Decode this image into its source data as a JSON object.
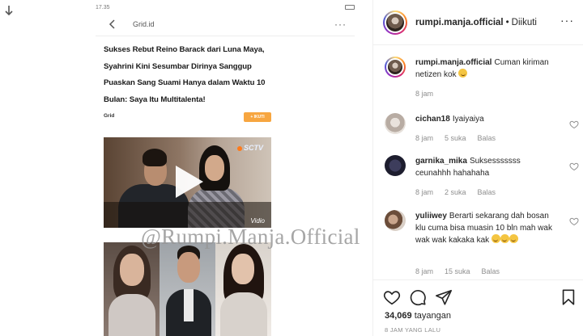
{
  "post": {
    "app_title": "Grid.id",
    "phone_time": "17.35",
    "headline": "Sukses Rebut Reino Barack dari Luna Maya, Syahrini Kini Sesumbar Dirinya Sanggup Puaskan Sang Suami Hanya dalam Waktu 10 Bulan: Saya Itu Multitalenta!",
    "source": "Grid",
    "follow_label": "+ IKUTI",
    "video_channel": "SCTV",
    "video_brand": "Vidio",
    "watermark": "@Rumpi.Manja.Official"
  },
  "header": {
    "username": "rumpi.manja.official",
    "separator": "•",
    "following": "Diikuti",
    "more": "···"
  },
  "caption": {
    "username": "rumpi.manja.official",
    "text": "Cuman kiriman netizen kok",
    "time": "8 jam"
  },
  "comments": [
    {
      "username": "cichan18",
      "text": "Iyaiyaiya",
      "time": "8 jam",
      "likes": "5 suka",
      "reply": "Balas"
    },
    {
      "username": "garnika_mika",
      "text": "Suksesssssss ceunahhh hahahaha",
      "time": "8 jam",
      "likes": "2 suka",
      "reply": "Balas"
    },
    {
      "username": "yuliiwey",
      "text": "Berarti sekarang dah bosan klu cuma bisa muasin 10 bln mah wak wak wak kakaka kak",
      "time": "8 jam",
      "likes": "15 suka",
      "reply": "Balas"
    }
  ],
  "footer": {
    "views_count": "34,069",
    "views_label": "tayangan",
    "posted_ago": "8 JAM YANG LALU"
  },
  "colors": {
    "follow_button": "#f7a640",
    "text": "#262626",
    "muted": "#8e8e8e",
    "border": "#efefef"
  },
  "icons": [
    "download-arrow-icon",
    "back-chevron-icon",
    "more-icon",
    "play-icon",
    "heart-icon",
    "comment-icon",
    "share-icon",
    "bookmark-icon",
    "grinning-emoji-icon"
  ]
}
